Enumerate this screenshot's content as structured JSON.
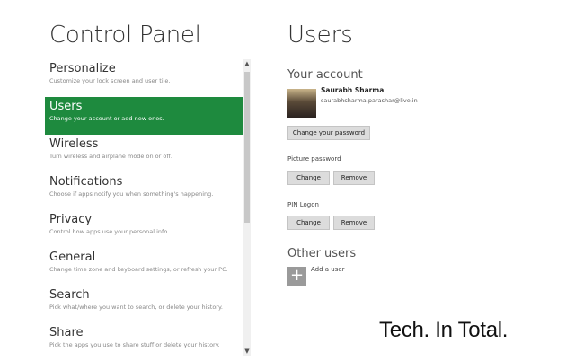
{
  "left": {
    "title": "Control Panel",
    "items": [
      {
        "name": "Personalize",
        "desc": "Customize your lock screen and user tile."
      },
      {
        "name": "Users",
        "desc": "Change your account or add new ones."
      },
      {
        "name": "Wireless",
        "desc": "Turn wireless and airplane mode on or off."
      },
      {
        "name": "Notifications",
        "desc": "Choose if apps notify you when something's happening."
      },
      {
        "name": "Privacy",
        "desc": "Control how apps use your personal info."
      },
      {
        "name": "General",
        "desc": "Change time zone and keyboard settings, or refresh your PC."
      },
      {
        "name": "Search",
        "desc": "Pick what/where you want to search, or delete your history."
      },
      {
        "name": "Share",
        "desc": "Pick the apps you use to share stuff or delete your history."
      }
    ],
    "selected_index": 1
  },
  "right": {
    "title": "Users",
    "your_account": "Your account",
    "account_name": "Saurabh Sharma",
    "account_email": "saurabhsharma.parashar@live.in",
    "change_password": "Change your password",
    "picture_password": "Picture password",
    "pin_logon": "PIN Logon",
    "change_label": "Change",
    "remove_label": "Remove",
    "other_users": "Other users",
    "add_user": "Add a user"
  },
  "watermark": "Tech. In Total.",
  "colors": {
    "accent": "#1e8a3e"
  }
}
